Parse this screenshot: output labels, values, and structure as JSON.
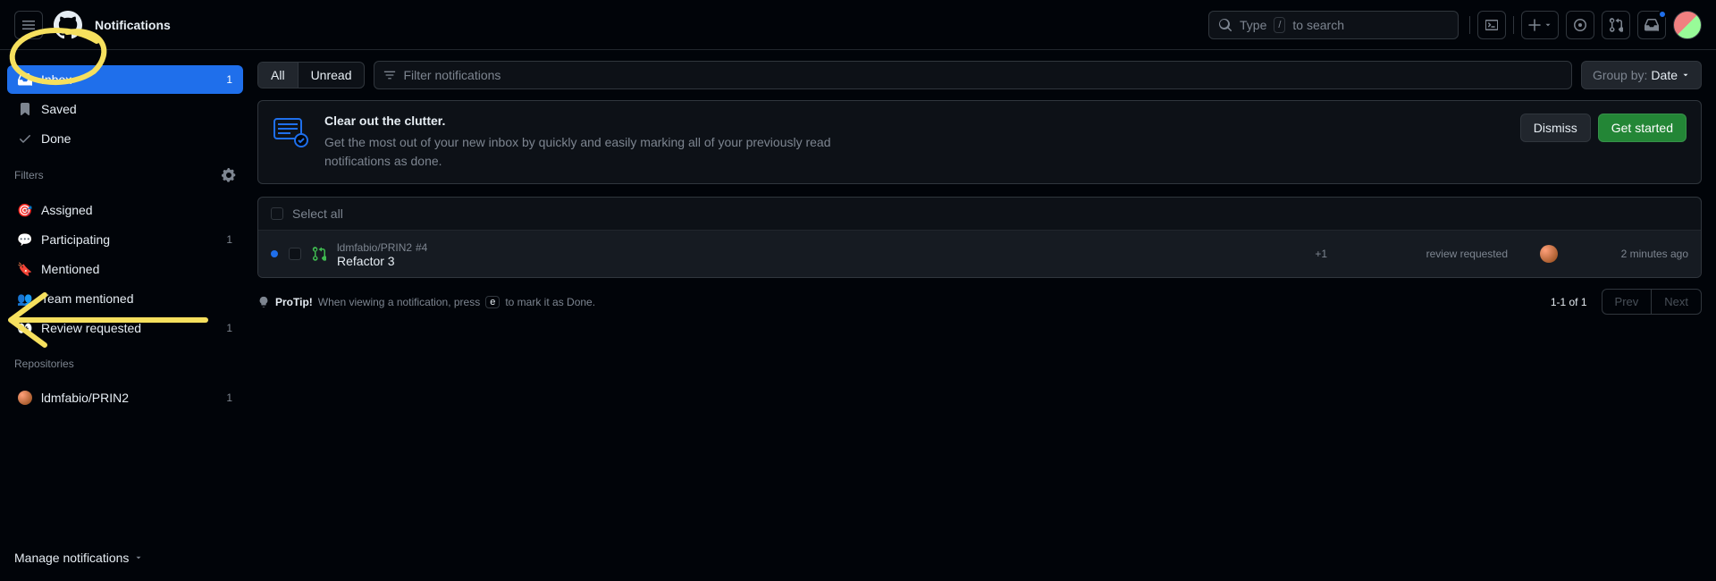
{
  "header": {
    "title": "Notifications",
    "search_prefix": "Type",
    "search_key": "/",
    "search_suffix": "to search"
  },
  "sidebar": {
    "primary": [
      {
        "icon": "inbox",
        "label": "Inbox",
        "count": "1",
        "active": true
      },
      {
        "icon": "bookmark",
        "label": "Saved",
        "count": "",
        "active": false
      },
      {
        "icon": "check",
        "label": "Done",
        "count": "",
        "active": false
      }
    ],
    "filters_header": "Filters",
    "filters": [
      {
        "icon": "🎯",
        "label": "Assigned",
        "count": ""
      },
      {
        "icon": "💬",
        "label": "Participating",
        "count": "1"
      },
      {
        "icon": "🔖",
        "label": "Mentioned",
        "count": ""
      },
      {
        "icon": "👥",
        "label": "Team mentioned",
        "count": ""
      },
      {
        "icon": "👀",
        "label": "Review requested",
        "count": "1"
      }
    ],
    "repos_header": "Repositories",
    "repos": [
      {
        "label": "ldmfabio/PRIN2",
        "count": "1"
      }
    ],
    "manage_label": "Manage notifications"
  },
  "toolbar": {
    "all": "All",
    "unread": "Unread",
    "filter_placeholder": "Filter notifications",
    "group_by_prefix": "Group by:",
    "group_by_value": "Date"
  },
  "banner": {
    "title": "Clear out the clutter.",
    "desc": "Get the most out of your new inbox by quickly and easily marking all of your previously read notifications as done.",
    "dismiss": "Dismiss",
    "get_started": "Get started"
  },
  "list": {
    "select_all": "Select all",
    "rows": [
      {
        "repo": "ldmfabio/PRIN2",
        "num": "#4",
        "title": "Refactor 3",
        "plus": "+1",
        "reason": "review requested",
        "time": "2 minutes ago"
      }
    ]
  },
  "protip": {
    "label": "ProTip!",
    "before": "When viewing a notification, press",
    "key": "e",
    "after": "to mark it as Done."
  },
  "pager": {
    "range": "1-1 of 1",
    "prev": "Prev",
    "next": "Next"
  }
}
